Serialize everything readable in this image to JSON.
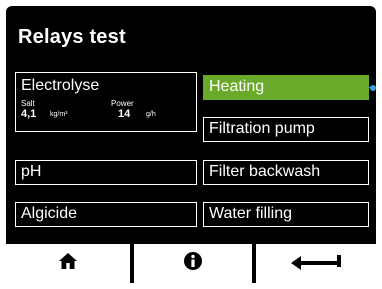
{
  "header": {
    "title": "Relays test"
  },
  "relays": {
    "electrolyse": {
      "label": "Electrolyse",
      "salt_label": "Salt",
      "salt_value": "4,1",
      "salt_unit": "kg/m³",
      "power_label": "Power",
      "power_value": "14",
      "power_unit": "g/h"
    },
    "heating": {
      "label": "Heating",
      "active": true,
      "active_color": "#6aaa2a"
    },
    "filtration_pump": {
      "label": "Filtration pump"
    },
    "ph": {
      "label": "pH"
    },
    "filter_backwash": {
      "label": "Filter backwash"
    },
    "algicide": {
      "label": "Algicide"
    },
    "water_filling": {
      "label": "Water filling"
    }
  },
  "footer": {
    "home_icon": "home-icon",
    "info_icon": "info-icon",
    "back_icon": "back-arrow-icon"
  },
  "colors": {
    "screen_background": "#000000",
    "active_relay": "#6aaa2a",
    "hint_marker": "#3aa0d8",
    "footer_background": "#ffffff"
  }
}
